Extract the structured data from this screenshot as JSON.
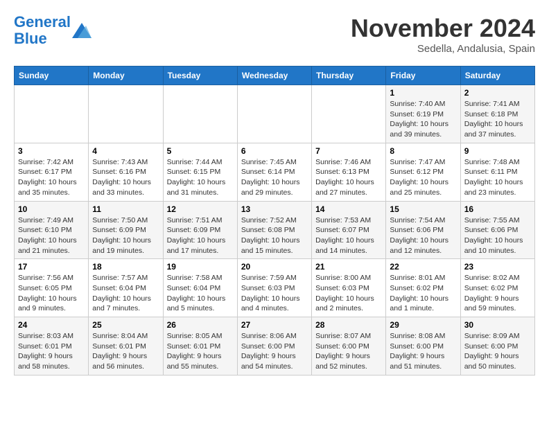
{
  "logo": {
    "line1": "General",
    "line2": "Blue"
  },
  "title": "November 2024",
  "location": "Sedella, Andalusia, Spain",
  "weekdays": [
    "Sunday",
    "Monday",
    "Tuesday",
    "Wednesday",
    "Thursday",
    "Friday",
    "Saturday"
  ],
  "weeks": [
    [
      {
        "day": "",
        "info": ""
      },
      {
        "day": "",
        "info": ""
      },
      {
        "day": "",
        "info": ""
      },
      {
        "day": "",
        "info": ""
      },
      {
        "day": "",
        "info": ""
      },
      {
        "day": "1",
        "info": "Sunrise: 7:40 AM\nSunset: 6:19 PM\nDaylight: 10 hours and 39 minutes."
      },
      {
        "day": "2",
        "info": "Sunrise: 7:41 AM\nSunset: 6:18 PM\nDaylight: 10 hours and 37 minutes."
      }
    ],
    [
      {
        "day": "3",
        "info": "Sunrise: 7:42 AM\nSunset: 6:17 PM\nDaylight: 10 hours and 35 minutes."
      },
      {
        "day": "4",
        "info": "Sunrise: 7:43 AM\nSunset: 6:16 PM\nDaylight: 10 hours and 33 minutes."
      },
      {
        "day": "5",
        "info": "Sunrise: 7:44 AM\nSunset: 6:15 PM\nDaylight: 10 hours and 31 minutes."
      },
      {
        "day": "6",
        "info": "Sunrise: 7:45 AM\nSunset: 6:14 PM\nDaylight: 10 hours and 29 minutes."
      },
      {
        "day": "7",
        "info": "Sunrise: 7:46 AM\nSunset: 6:13 PM\nDaylight: 10 hours and 27 minutes."
      },
      {
        "day": "8",
        "info": "Sunrise: 7:47 AM\nSunset: 6:12 PM\nDaylight: 10 hours and 25 minutes."
      },
      {
        "day": "9",
        "info": "Sunrise: 7:48 AM\nSunset: 6:11 PM\nDaylight: 10 hours and 23 minutes."
      }
    ],
    [
      {
        "day": "10",
        "info": "Sunrise: 7:49 AM\nSunset: 6:10 PM\nDaylight: 10 hours and 21 minutes."
      },
      {
        "day": "11",
        "info": "Sunrise: 7:50 AM\nSunset: 6:09 PM\nDaylight: 10 hours and 19 minutes."
      },
      {
        "day": "12",
        "info": "Sunrise: 7:51 AM\nSunset: 6:09 PM\nDaylight: 10 hours and 17 minutes."
      },
      {
        "day": "13",
        "info": "Sunrise: 7:52 AM\nSunset: 6:08 PM\nDaylight: 10 hours and 15 minutes."
      },
      {
        "day": "14",
        "info": "Sunrise: 7:53 AM\nSunset: 6:07 PM\nDaylight: 10 hours and 14 minutes."
      },
      {
        "day": "15",
        "info": "Sunrise: 7:54 AM\nSunset: 6:06 PM\nDaylight: 10 hours and 12 minutes."
      },
      {
        "day": "16",
        "info": "Sunrise: 7:55 AM\nSunset: 6:06 PM\nDaylight: 10 hours and 10 minutes."
      }
    ],
    [
      {
        "day": "17",
        "info": "Sunrise: 7:56 AM\nSunset: 6:05 PM\nDaylight: 10 hours and 9 minutes."
      },
      {
        "day": "18",
        "info": "Sunrise: 7:57 AM\nSunset: 6:04 PM\nDaylight: 10 hours and 7 minutes."
      },
      {
        "day": "19",
        "info": "Sunrise: 7:58 AM\nSunset: 6:04 PM\nDaylight: 10 hours and 5 minutes."
      },
      {
        "day": "20",
        "info": "Sunrise: 7:59 AM\nSunset: 6:03 PM\nDaylight: 10 hours and 4 minutes."
      },
      {
        "day": "21",
        "info": "Sunrise: 8:00 AM\nSunset: 6:03 PM\nDaylight: 10 hours and 2 minutes."
      },
      {
        "day": "22",
        "info": "Sunrise: 8:01 AM\nSunset: 6:02 PM\nDaylight: 10 hours and 1 minute."
      },
      {
        "day": "23",
        "info": "Sunrise: 8:02 AM\nSunset: 6:02 PM\nDaylight: 9 hours and 59 minutes."
      }
    ],
    [
      {
        "day": "24",
        "info": "Sunrise: 8:03 AM\nSunset: 6:01 PM\nDaylight: 9 hours and 58 minutes."
      },
      {
        "day": "25",
        "info": "Sunrise: 8:04 AM\nSunset: 6:01 PM\nDaylight: 9 hours and 56 minutes."
      },
      {
        "day": "26",
        "info": "Sunrise: 8:05 AM\nSunset: 6:01 PM\nDaylight: 9 hours and 55 minutes."
      },
      {
        "day": "27",
        "info": "Sunrise: 8:06 AM\nSunset: 6:00 PM\nDaylight: 9 hours and 54 minutes."
      },
      {
        "day": "28",
        "info": "Sunrise: 8:07 AM\nSunset: 6:00 PM\nDaylight: 9 hours and 52 minutes."
      },
      {
        "day": "29",
        "info": "Sunrise: 8:08 AM\nSunset: 6:00 PM\nDaylight: 9 hours and 51 minutes."
      },
      {
        "day": "30",
        "info": "Sunrise: 8:09 AM\nSunset: 6:00 PM\nDaylight: 9 hours and 50 minutes."
      }
    ]
  ]
}
